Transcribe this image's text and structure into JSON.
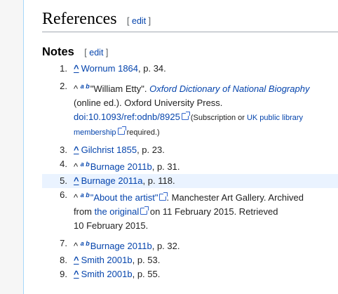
{
  "section": {
    "title": "References",
    "edit_open": "[",
    "edit_label": "edit",
    "edit_close": "]"
  },
  "subsection": {
    "title": "Notes",
    "edit_open": "[",
    "edit_label": "edit",
    "edit_close": "]"
  },
  "notes": [
    {
      "num": "1.",
      "caret": "^",
      "link": "Wornum 1864",
      "rest": ", p. 34."
    },
    {
      "num": "2.",
      "caret": "^",
      "b1": "a",
      "b2": "b",
      "title": "\"William Etty\". ",
      "journal": "Oxford Dictionary of National Biography",
      "line2": "(online ed.). Oxford University Press.",
      "doi": "doi:10.1093/ref:odnb/8925",
      "note1": " (Subscription or ",
      "note_link1": "UK public library",
      "note_link2": "membership",
      "note2": " required.)"
    },
    {
      "num": "3.",
      "caret": "^",
      "link": "Gilchrist 1855",
      "rest": ", p. 23."
    },
    {
      "num": "4.",
      "caret": "^",
      "b1": "a",
      "b2": "b",
      "link": "Burnage 2011b",
      "rest": ", p. 31."
    },
    {
      "num": "5.",
      "caret": "^",
      "link": "Burnage 2011a",
      "rest": ", p. 118."
    },
    {
      "num": "6.",
      "caret": "^",
      "b1": "a",
      "b2": "b",
      "link": "\"About the artist\"",
      "rest": ". Manchester Art Gallery. Archived",
      "line2a": "from ",
      "line2link": "the original",
      "line2b": " on 11 February 2015. Retrieved",
      "line3": "10 February 2015."
    },
    {
      "num": "7.",
      "caret": "^",
      "b1": "a",
      "b2": "b",
      "link": "Burnage 2011b",
      "rest": ", p. 32."
    },
    {
      "num": "8.",
      "caret": "^",
      "link": "Smith 2001b",
      "rest": ", p. 53."
    },
    {
      "num": "9.",
      "caret": "^",
      "link": "Smith 2001b",
      "rest": ", p. 55."
    }
  ]
}
